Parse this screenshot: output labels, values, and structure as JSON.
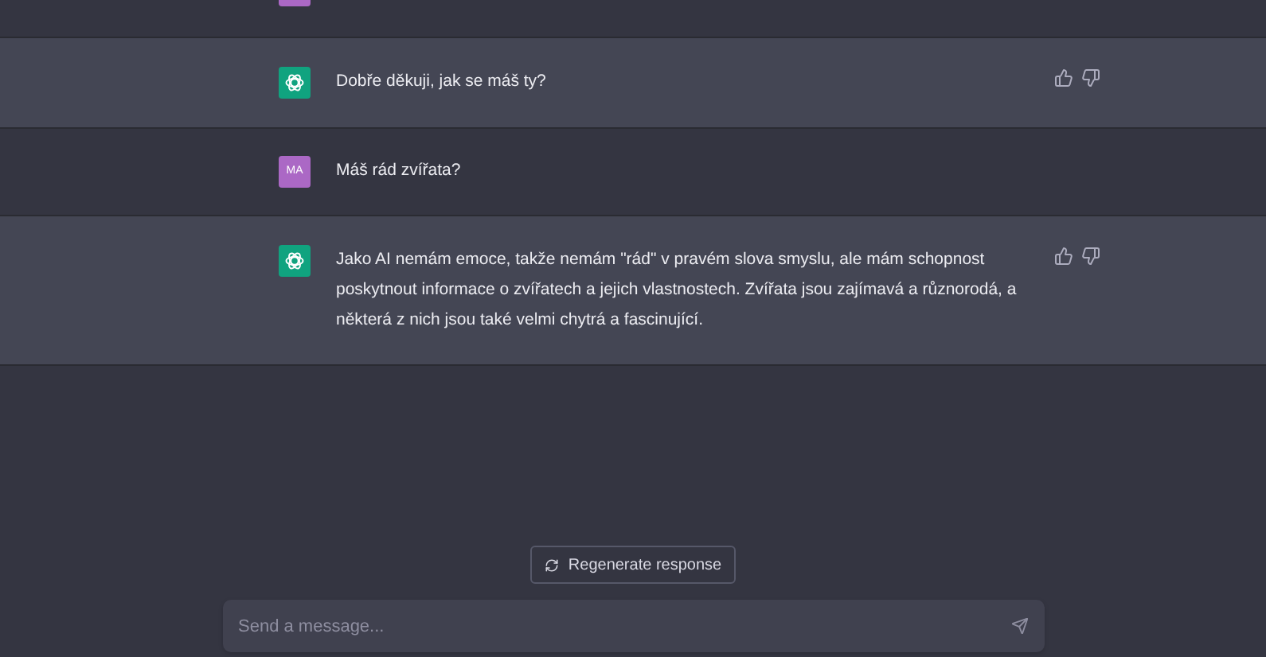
{
  "messages": [
    {
      "kind": "user",
      "clipped": true
    },
    {
      "kind": "assistant",
      "text": "Dobře děkuji, jak se máš ty?",
      "feedback": true
    },
    {
      "kind": "user",
      "avatar": "MA",
      "text": "Máš rád zvířata?"
    },
    {
      "kind": "assistant",
      "text": "Jako AI nemám emoce, takže nemám \"rád\" v pravém slova smyslu, ale mám schopnost poskytnout informace o zvířatech a jejich vlastnostech. Zvířata jsou zajímavá a různorodá, a některá z nich jsou také velmi chytrá a fascinující.",
      "feedback": true
    }
  ],
  "regenerate_button": "Regenerate response",
  "composer": {
    "placeholder": "Send a message..."
  }
}
